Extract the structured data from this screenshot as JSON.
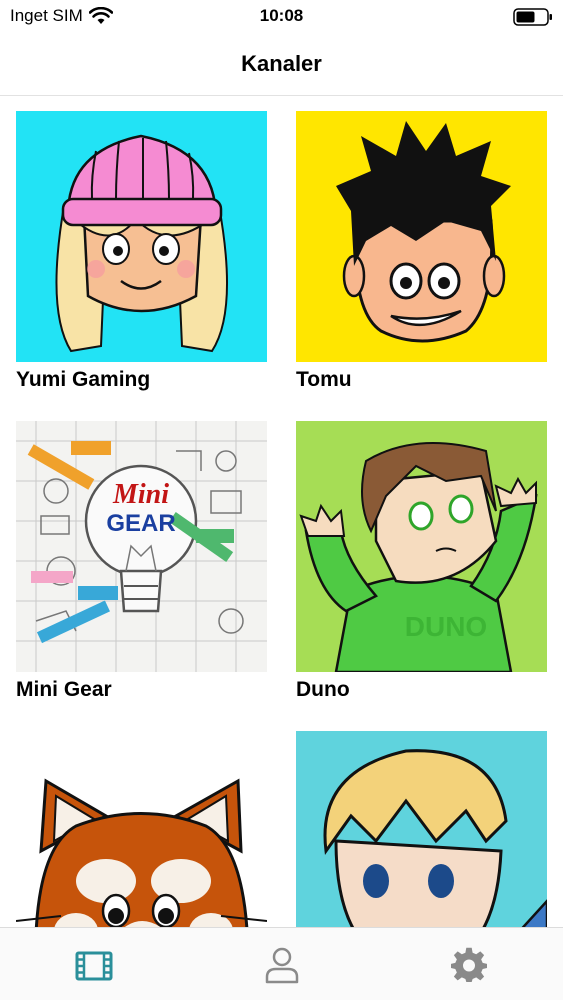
{
  "status_bar": {
    "carrier": "Inget SIM",
    "time": "10:08",
    "icons": [
      "wifi-icon",
      "battery-icon"
    ]
  },
  "nav": {
    "title": "Kanaler"
  },
  "channels": [
    {
      "title": "Yumi Gaming",
      "thumb_bg": "#22e3f5"
    },
    {
      "title": "Tomu",
      "thumb_bg": "#ffe600"
    },
    {
      "title": "Mini Gear",
      "thumb_bg": "#f3f3f1",
      "logo_text_1": "Mini",
      "logo_text_2": "GEAR"
    },
    {
      "title": "Duno",
      "thumb_bg": "#a6dd55"
    },
    {
      "title": "",
      "thumb_bg": "#ffffff"
    },
    {
      "title": "",
      "thumb_bg": "#5fd3dd"
    }
  ],
  "tab_bar": {
    "tabs": [
      {
        "icon": "film-icon",
        "active": true
      },
      {
        "icon": "person-icon",
        "active": false
      },
      {
        "icon": "gear-icon",
        "active": false
      }
    ],
    "active_color": "#2a8f9a",
    "inactive_color": "#8a8a8a"
  }
}
